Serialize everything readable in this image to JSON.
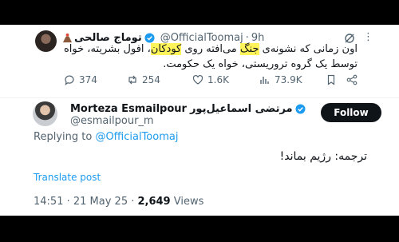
{
  "post": {
    "display_name": "توماج صالحی",
    "handle": "@OfficialToomaj",
    "separator": "·",
    "time": "9h",
    "text_before": "اون زمانی که نشونه‌ی ",
    "text_hl1": "جنگ",
    "text_mid": " می‌افته روی ",
    "text_hl2": "کودکان",
    "text_after": "، افول بشریته، خواه توسط یک گروه تروریستی، خواه یک حکومت.",
    "actions": {
      "replies": "374",
      "reposts": "254",
      "likes": "1.6K",
      "views": "73.9K"
    }
  },
  "reply": {
    "display_name_en": "Morteza Esmailpour",
    "display_name_fa": "مرتضی اسماعیل‌پور",
    "handle": "@esmailpour_m",
    "follow_label": "Follow",
    "replying_prefix": "Replying to",
    "replying_handle": "@OfficialToomaj",
    "text": "ترجمه: رژیم بماند!",
    "translate_label": "Translate post",
    "timestamp": "14:51 · 21 May 25 · ",
    "views_count": "2,649",
    "views_label": " Views"
  },
  "colors": {
    "accent": "#1d9bf0",
    "highlight": "#fff45a",
    "muted": "#536471"
  }
}
